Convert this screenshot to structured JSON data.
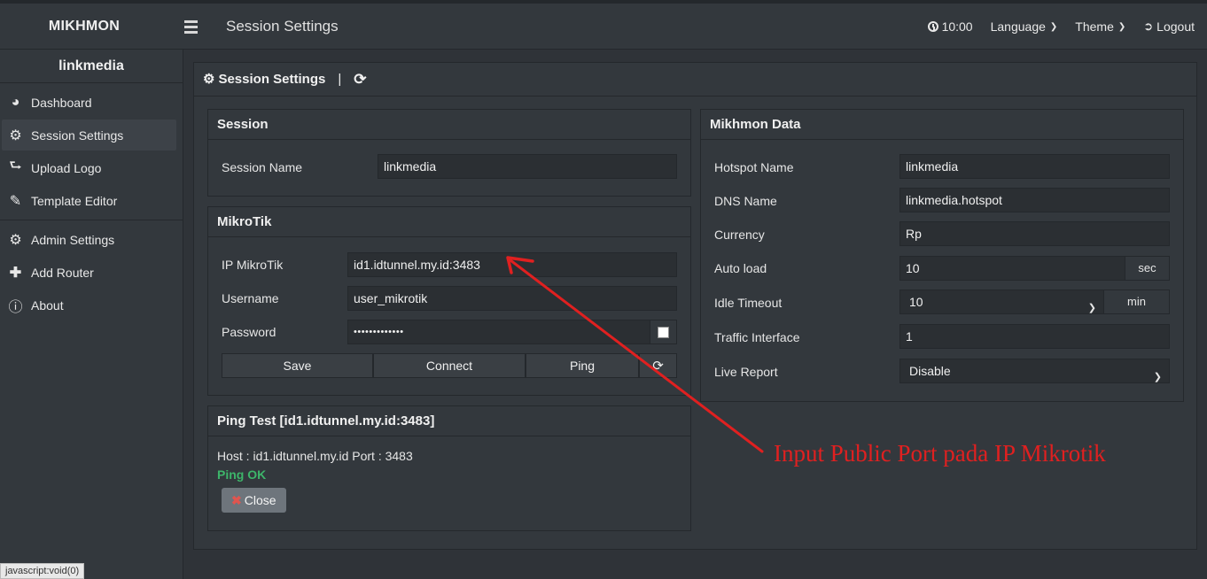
{
  "app": {
    "brand": "MIKHMON",
    "page_title": "Session Settings"
  },
  "topbar": {
    "time": "10:00",
    "language": "Language",
    "theme": "Theme",
    "logout": "Logout"
  },
  "sidebar": {
    "user": "linkmedia",
    "items": [
      {
        "label": "Dashboard",
        "icon": "dashboard-icon"
      },
      {
        "label": "Session Settings",
        "icon": "gear-icon",
        "active": true
      },
      {
        "label": "Upload Logo",
        "icon": "upload-icon"
      },
      {
        "label": "Template Editor",
        "icon": "edit-icon"
      },
      {
        "label": "Admin Settings",
        "icon": "gear-icon"
      },
      {
        "label": "Add Router",
        "icon": "plus-icon"
      },
      {
        "label": "About",
        "icon": "info-icon"
      }
    ]
  },
  "main": {
    "title": "Session Settings",
    "separator": "|"
  },
  "session": {
    "heading": "Session",
    "name_label": "Session Name",
    "name_value": "linkmedia"
  },
  "mikrotik": {
    "heading": "MikroTik",
    "ip_label": "IP MikroTik",
    "ip_value": "id1.idtunnel.my.id:3483",
    "user_label": "Username",
    "user_value": "user_mikrotik",
    "pass_label": "Password",
    "pass_value": "•••••••••••••",
    "save": "Save",
    "connect": "Connect",
    "ping": "Ping"
  },
  "ping_test": {
    "heading": "Ping Test [id1.idtunnel.my.id:3483]",
    "result": "Host : id1.idtunnel.my.id Port : 3483",
    "status": "Ping OK",
    "close": "Close"
  },
  "mikhmon_data": {
    "heading": "Mikhmon Data",
    "hotspot_label": "Hotspot Name",
    "hotspot_value": "linkmedia",
    "dns_label": "DNS Name",
    "dns_value": "linkmedia.hotspot",
    "currency_label": "Currency",
    "currency_value": "Rp",
    "autoload_label": "Auto load",
    "autoload_value": "10",
    "autoload_unit": "sec",
    "idle_label": "Idle Timeout",
    "idle_value": "10",
    "idle_unit": "min",
    "traffic_label": "Traffic Interface",
    "traffic_value": "1",
    "live_label": "Live Report",
    "live_value": "Disable"
  },
  "annotation": {
    "text": "Input Public Port pada IP Mikrotik",
    "color": "#e02020"
  },
  "statusbar": {
    "text": "javascript:void(0)"
  }
}
